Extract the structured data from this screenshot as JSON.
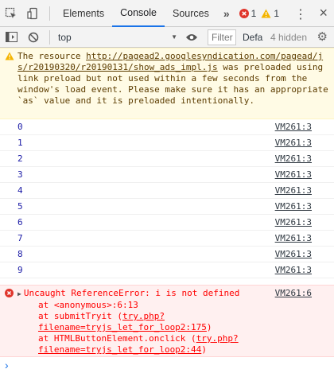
{
  "tabs": {
    "elements": "Elements",
    "console": "Console",
    "sources": "Sources",
    "more": "»",
    "error_count": "1",
    "warning_count": "1"
  },
  "toolbar": {
    "context": "top",
    "filter_placeholder": "Filter",
    "levels": "Defa",
    "hidden": "4 hidden"
  },
  "warning": {
    "prefix": "The resource ",
    "url": "http://pagead2.googlesyndication.com/pagead/js/r20190320/r20190131/show_ads_impl.js",
    "suffix": " was preloaded using link preload but not used within a few seconds from the window's load event. Please make sure it has an appropriate `as` value and it is preloaded intentionally."
  },
  "logs": [
    {
      "value": "0",
      "source": "VM261:3"
    },
    {
      "value": "1",
      "source": "VM261:3"
    },
    {
      "value": "2",
      "source": "VM261:3"
    },
    {
      "value": "3",
      "source": "VM261:3"
    },
    {
      "value": "4",
      "source": "VM261:3"
    },
    {
      "value": "5",
      "source": "VM261:3"
    },
    {
      "value": "6",
      "source": "VM261:3"
    },
    {
      "value": "7",
      "source": "VM261:3"
    },
    {
      "value": "8",
      "source": "VM261:3"
    },
    {
      "value": "9",
      "source": "VM261:3"
    }
  ],
  "error": {
    "message": "Uncaught ReferenceError: i is not defined",
    "source": "VM261:6",
    "stack1": "at <anonymous>:6:13",
    "stack2_prefix": "at submitTryit (",
    "stack2_link": "try.php?filename=tryjs_let_for_loop2:175",
    "stack2_suffix": ")",
    "stack3_prefix": "at HTMLButtonElement.onclick (",
    "stack3_link": "try.php?filename=tryjs_let_for_loop2:44",
    "stack3_suffix": ")"
  },
  "colors": {
    "accent": "#1a73e8",
    "error": "#ff0000",
    "warning_bg": "#fffbe5",
    "error_bg": "#fff0f0"
  }
}
